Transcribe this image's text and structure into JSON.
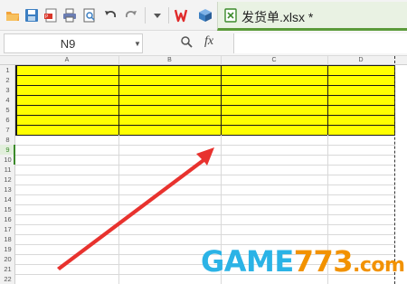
{
  "toolbar": {
    "icons": [
      "open-folder-icon",
      "save-icon",
      "pdf-export-icon",
      "print-icon",
      "print-preview-icon",
      "undo-icon",
      "redo-icon",
      "dropdown-icon",
      "wps-logo-icon",
      "cube-icon"
    ],
    "active_tab": {
      "title": "发货单.xlsx *",
      "icon": "spreadsheet-file-icon"
    }
  },
  "formula_bar": {
    "name_box": "N9",
    "fx_label": "fx",
    "formula": ""
  },
  "sheet": {
    "columns": [
      "A",
      "B",
      "C",
      "D"
    ],
    "rows": [
      "1",
      "2",
      "3",
      "4",
      "5",
      "6",
      "7",
      "8",
      "9",
      "10",
      "11",
      "12",
      "13",
      "14",
      "15",
      "16",
      "17",
      "18",
      "19",
      "20",
      "21",
      "22"
    ],
    "active_row": "9",
    "highlight_color": "#ffff00",
    "highlighted_rows": [
      "1",
      "2",
      "3",
      "4",
      "5",
      "6",
      "7"
    ]
  },
  "annotation": {
    "arrow_color": "#e8322e"
  },
  "watermark": {
    "part1": "GAME",
    "part2": "773",
    "part3": ".com"
  }
}
